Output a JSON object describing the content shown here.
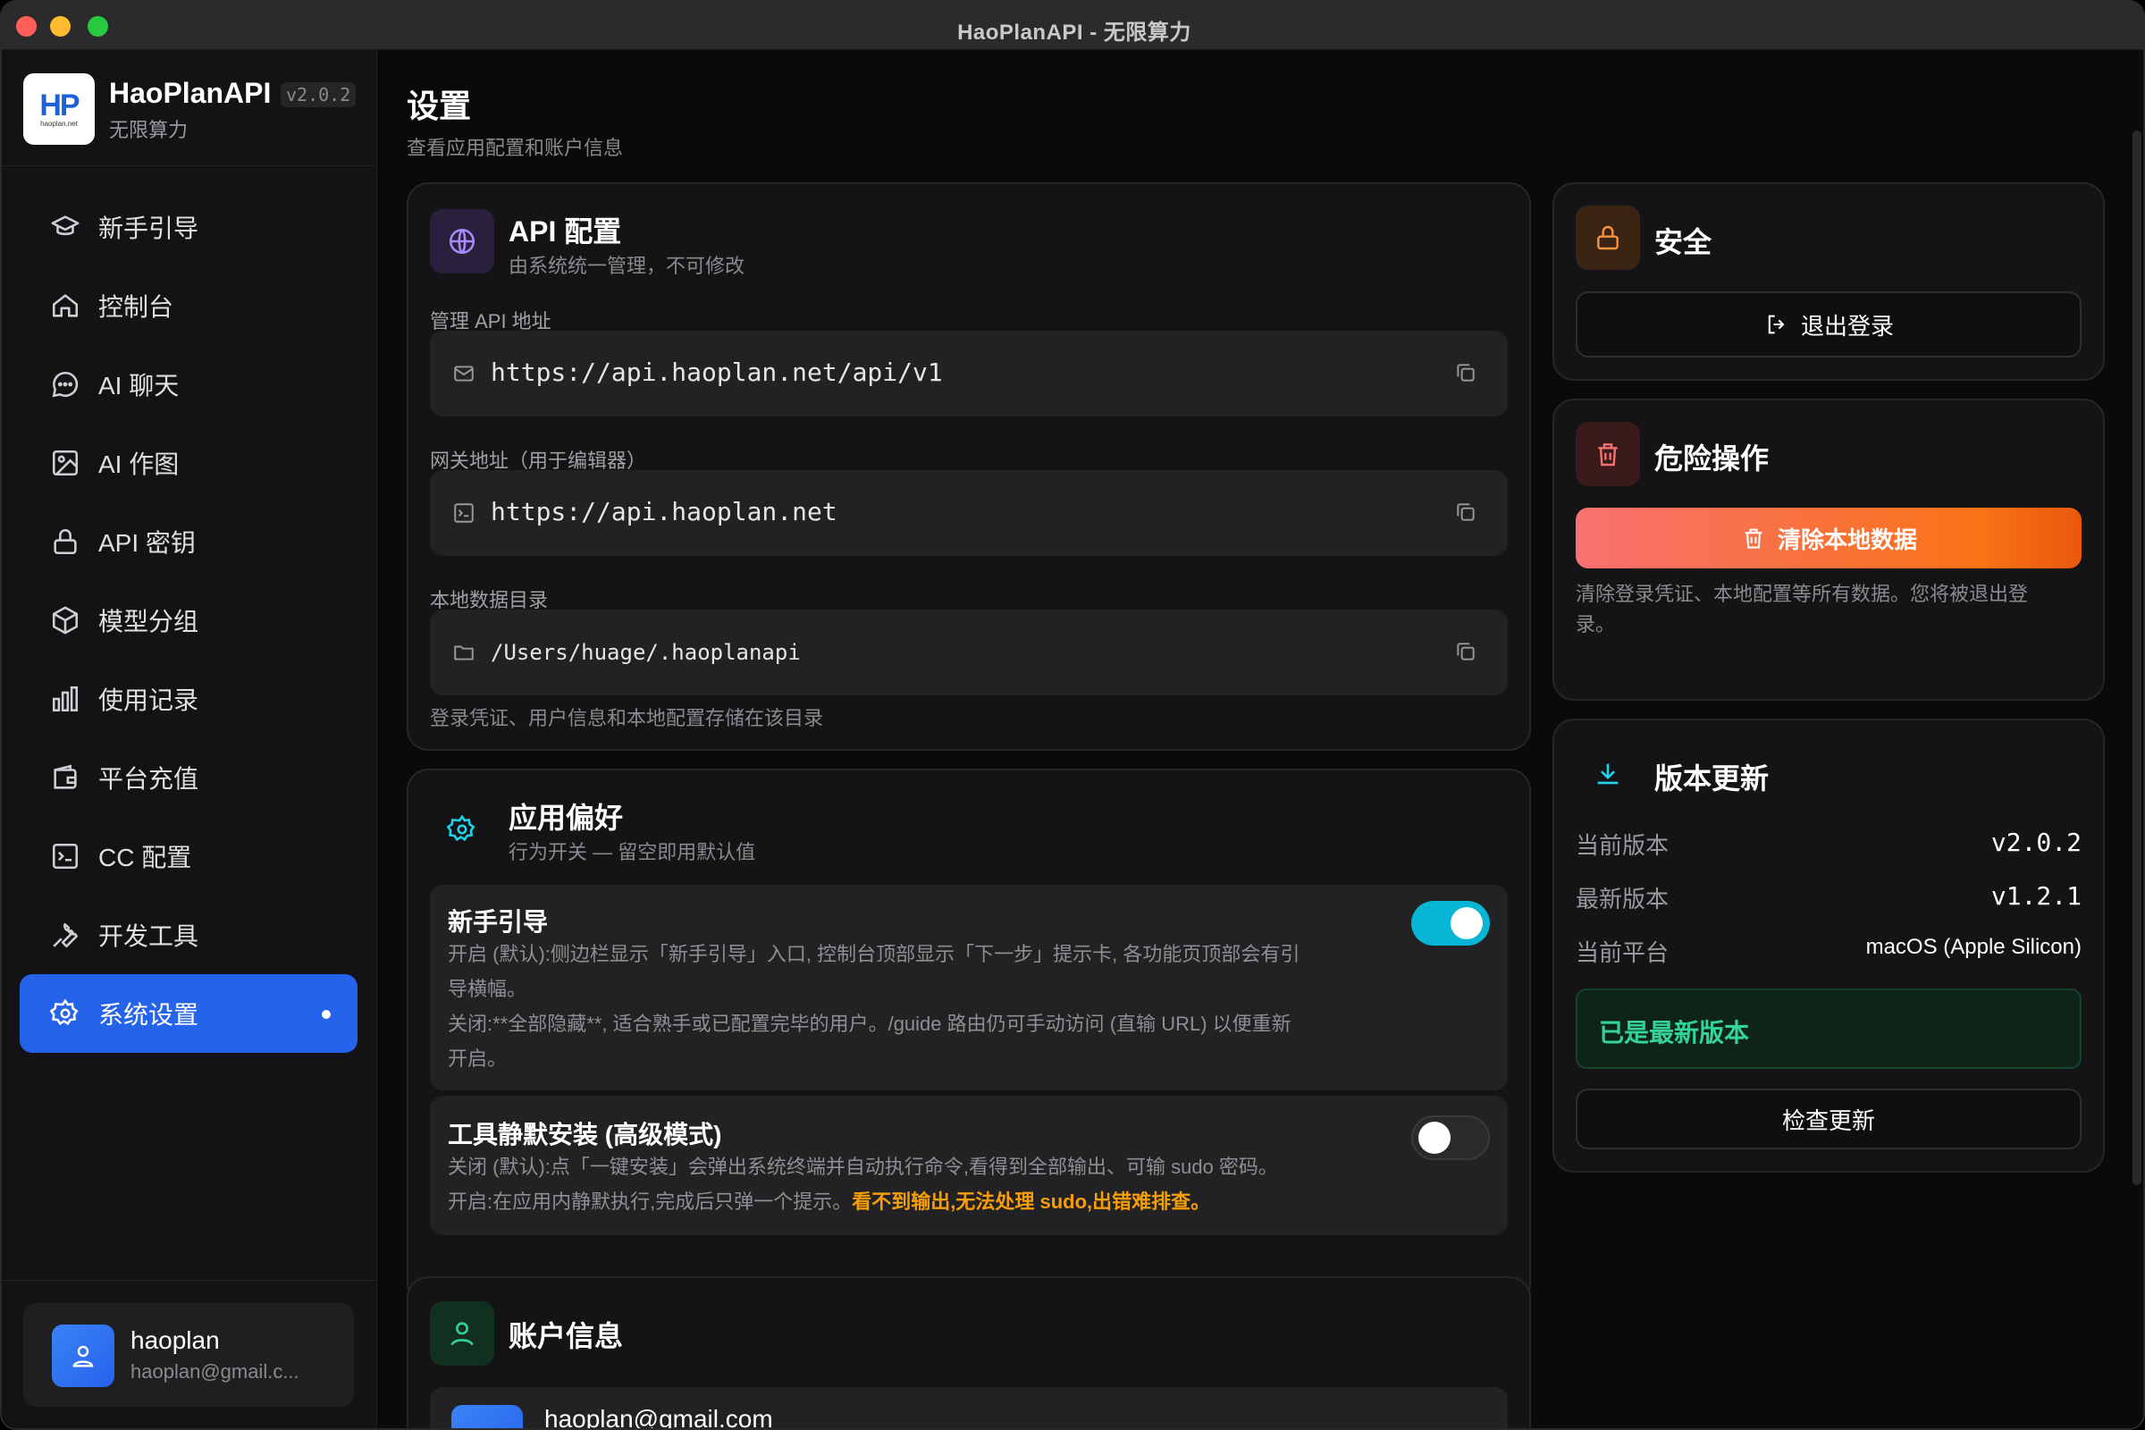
{
  "window": {
    "title": "HaoPlanAPI - 无限算力"
  },
  "brand": {
    "logo": "HP",
    "logo_sub": "haoplan.net",
    "name": "HaoPlanAPI",
    "version": "v2.0.2",
    "tagline": "无限算力"
  },
  "sidebar": {
    "items": [
      {
        "label": "新手引导",
        "icon": "graduation-cap-icon"
      },
      {
        "label": "控制台",
        "icon": "home-icon"
      },
      {
        "label": "AI 聊天",
        "icon": "chat-bubble-icon"
      },
      {
        "label": "AI 作图",
        "icon": "image-icon"
      },
      {
        "label": "API 密钥",
        "icon": "lock-icon"
      },
      {
        "label": "模型分组",
        "icon": "cube-icon"
      },
      {
        "label": "使用记录",
        "icon": "bar-chart-icon"
      },
      {
        "label": "平台充值",
        "icon": "wallet-icon"
      },
      {
        "label": "CC 配置",
        "icon": "terminal-icon"
      },
      {
        "label": "开发工具",
        "icon": "wrench-icon"
      },
      {
        "label": "系统设置",
        "icon": "gear-icon",
        "active": true
      }
    ],
    "user": {
      "name": "haoplan",
      "email": "haoplan@gmail.c..."
    }
  },
  "page": {
    "title": "设置",
    "subtitle": "查看应用配置和账户信息"
  },
  "api_config": {
    "title": "API 配置",
    "subtitle": "由系统统一管理，不可修改",
    "fields": [
      {
        "label": "管理 API 地址",
        "value": "https://api.haoplan.net/api/v1",
        "icon": "mail-icon"
      },
      {
        "label": "网关地址（用于编辑器）",
        "value": "https://api.haoplan.net",
        "icon": "terminal-icon"
      },
      {
        "label": "本地数据目录",
        "value": "/Users/huage/.haoplanapi",
        "icon": "folder-icon"
      }
    ],
    "note": "登录凭证、用户信息和本地配置存储在该目录"
  },
  "preferences": {
    "title": "应用偏好",
    "subtitle": "行为开关 — 留空即用默认值",
    "items": [
      {
        "title": "新手引导",
        "enabled": true,
        "desc_lines": [
          "开启 (默认):侧边栏显示「新手引导」入口, 控制台顶部显示「下一步」提示卡, 各功能页顶部会有引",
          "导横幅。",
          "关闭:**全部隐藏**, 适合熟手或已配置完毕的用户。/guide 路由仍可手动访问 (直输 URL) 以便重新",
          "开启。"
        ]
      },
      {
        "title": "工具静默安装 (高级模式)",
        "enabled": false,
        "desc_line1": "关闭 (默认):点「一键安装」会弹出系统终端并自动执行命令,看得到全部输出、可输 sudo 密码。",
        "desc_line2": "开启:在应用内静默执行,完成后只弹一个提示。",
        "desc_warn": "看不到输出,无法处理 sudo,出错难排查。"
      }
    ]
  },
  "account": {
    "title": "账户信息",
    "email": "haoplan@gmail.com"
  },
  "security": {
    "title": "安全",
    "logout_label": "退出登录"
  },
  "danger": {
    "title": "危险操作",
    "clear_label": "清除本地数据",
    "clear_note_l1": "清除登录凭证、本地配置等所有数据。您将被退出登",
    "clear_note_l2": "录。"
  },
  "update": {
    "title": "版本更新",
    "rows": [
      {
        "key": "当前版本",
        "value": "v2.0.2"
      },
      {
        "key": "最新版本",
        "value": "v1.2.1"
      },
      {
        "key": "当前平台",
        "value": "macOS (Apple Silicon)"
      }
    ],
    "status": "已是最新版本",
    "check_label": "检查更新"
  },
  "colors": {
    "accent": "#2563eb",
    "toggle_on": "#06b6d4",
    "danger": "#f97316",
    "success": "#34d399",
    "warn": "#f59e0b"
  }
}
